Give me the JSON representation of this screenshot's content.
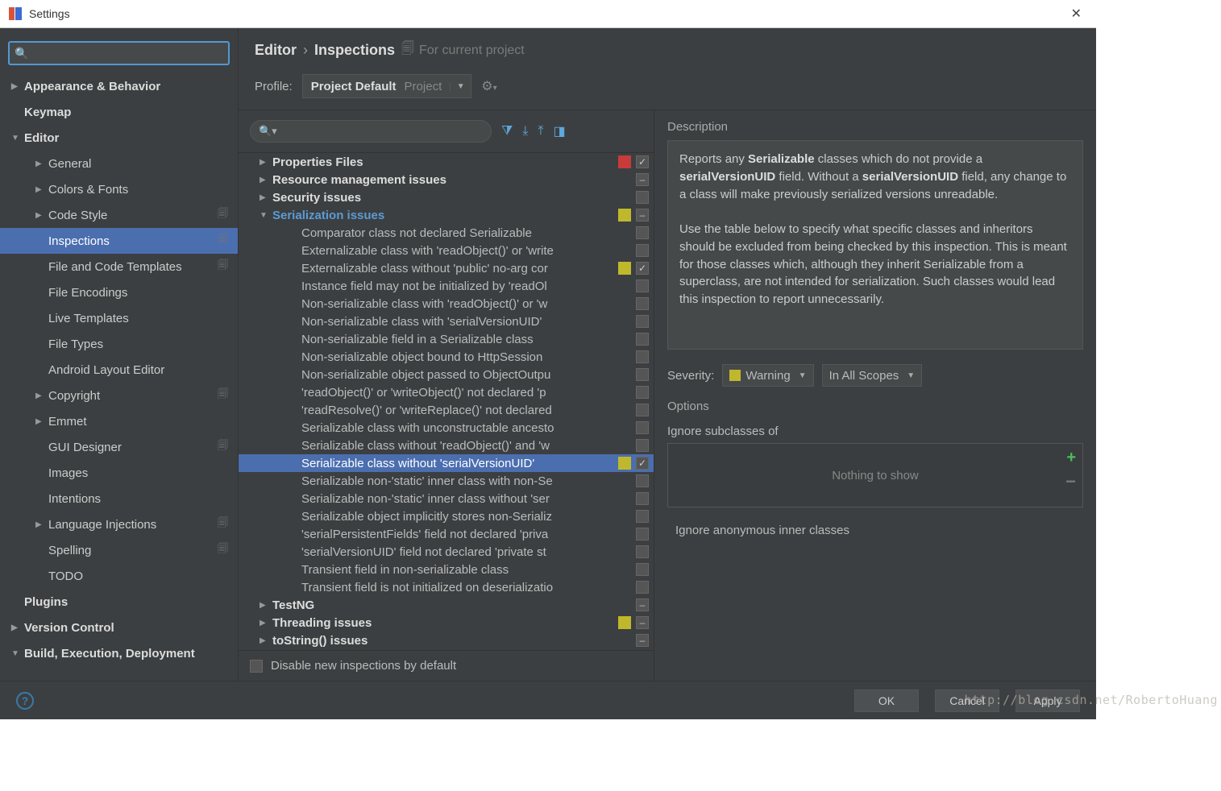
{
  "titlebar": {
    "title": "Settings"
  },
  "sidebar": {
    "search_placeholder": "",
    "items": [
      {
        "label": "Appearance & Behavior",
        "bold": true,
        "arrow": "closed"
      },
      {
        "label": "Keymap",
        "bold": true
      },
      {
        "label": "Editor",
        "bold": true,
        "arrow": "open"
      },
      {
        "label": "General",
        "sub": 1,
        "arrow": "closed"
      },
      {
        "label": "Colors & Fonts",
        "sub": 1,
        "arrow": "closed"
      },
      {
        "label": "Code Style",
        "sub": 1,
        "arrow": "closed",
        "copy": true
      },
      {
        "label": "Inspections",
        "sub": 1,
        "selected": true,
        "copy": true
      },
      {
        "label": "File and Code Templates",
        "sub": 1,
        "copy": true
      },
      {
        "label": "File Encodings",
        "sub": 1
      },
      {
        "label": "Live Templates",
        "sub": 1
      },
      {
        "label": "File Types",
        "sub": 1
      },
      {
        "label": "Android Layout Editor",
        "sub": 1
      },
      {
        "label": "Copyright",
        "sub": 1,
        "arrow": "closed",
        "copy": true
      },
      {
        "label": "Emmet",
        "sub": 1,
        "arrow": "closed"
      },
      {
        "label": "GUI Designer",
        "sub": 1,
        "copy": true
      },
      {
        "label": "Images",
        "sub": 1
      },
      {
        "label": "Intentions",
        "sub": 1
      },
      {
        "label": "Language Injections",
        "sub": 1,
        "arrow": "closed",
        "copy": true
      },
      {
        "label": "Spelling",
        "sub": 1,
        "copy": true
      },
      {
        "label": "TODO",
        "sub": 1
      },
      {
        "label": "Plugins",
        "bold": true
      },
      {
        "label": "Version Control",
        "bold": true,
        "arrow": "closed"
      },
      {
        "label": "Build, Execution, Deployment",
        "bold": true,
        "arrow": "open"
      }
    ]
  },
  "breadcrumb": {
    "root": "Editor",
    "leaf": "Inspections",
    "scope": "For current project"
  },
  "profile": {
    "label": "Profile:",
    "name": "Project Default",
    "hint": "Project"
  },
  "inspections": {
    "search_placeholder": "",
    "rows": [
      {
        "type": "cat",
        "arrow": "closed",
        "label": "Properties Files",
        "sq": "red",
        "cb": "checked"
      },
      {
        "type": "cat",
        "arrow": "closed",
        "label": "Resource management issues",
        "cb": "dash"
      },
      {
        "type": "cat",
        "arrow": "closed",
        "label": "Security issues",
        "cb": "off"
      },
      {
        "type": "cat",
        "arrow": "open",
        "label": "Serialization issues",
        "open_blue": true,
        "sq": "yellow",
        "cb": "dash"
      },
      {
        "type": "leaf",
        "label": "Comparator class not declared Serializable",
        "cb": "off"
      },
      {
        "type": "leaf",
        "label": "Externalizable class with 'readObject()' or 'write",
        "cb": "off"
      },
      {
        "type": "leaf",
        "label": "Externalizable class without 'public' no-arg cor",
        "sq": "yellow",
        "cb": "checked"
      },
      {
        "type": "leaf",
        "label": "Instance field may not be initialized by 'readOl",
        "cb": "off"
      },
      {
        "type": "leaf",
        "label": "Non-serializable class with 'readObject()' or 'w",
        "cb": "off"
      },
      {
        "type": "leaf",
        "label": "Non-serializable class with 'serialVersionUID'",
        "cb": "off"
      },
      {
        "type": "leaf",
        "label": "Non-serializable field in a Serializable class",
        "cb": "off"
      },
      {
        "type": "leaf",
        "label": "Non-serializable object bound to HttpSession",
        "cb": "off"
      },
      {
        "type": "leaf",
        "label": "Non-serializable object passed to ObjectOutpu",
        "cb": "off"
      },
      {
        "type": "leaf",
        "label": "'readObject()' or 'writeObject()' not declared 'p",
        "cb": "off"
      },
      {
        "type": "leaf",
        "label": "'readResolve()' or 'writeReplace()' not declared",
        "cb": "off"
      },
      {
        "type": "leaf",
        "label": "Serializable class with unconstructable ancesto",
        "cb": "off"
      },
      {
        "type": "leaf",
        "label": "Serializable class without 'readObject()' and 'w",
        "cb": "off"
      },
      {
        "type": "leaf",
        "label": "Serializable class without 'serialVersionUID'",
        "sq": "yellow",
        "cb": "checked",
        "selected": true
      },
      {
        "type": "leaf",
        "label": "Serializable non-'static' inner class with non-Se",
        "cb": "off"
      },
      {
        "type": "leaf",
        "label": "Serializable non-'static' inner class without 'ser",
        "cb": "off"
      },
      {
        "type": "leaf",
        "label": "Serializable object implicitly stores non-Serializ",
        "cb": "off"
      },
      {
        "type": "leaf",
        "label": "'serialPersistentFields' field not declared 'priva",
        "cb": "off"
      },
      {
        "type": "leaf",
        "label": "'serialVersionUID' field not declared 'private st",
        "cb": "off"
      },
      {
        "type": "leaf",
        "label": "Transient field in non-serializable class",
        "cb": "off"
      },
      {
        "type": "leaf",
        "label": "Transient field is not initialized on deserializatio",
        "cb": "off"
      },
      {
        "type": "cat",
        "arrow": "closed",
        "label": "TestNG",
        "cb": "dash"
      },
      {
        "type": "cat",
        "arrow": "closed",
        "label": "Threading issues",
        "sq": "yellow",
        "cb": "dash"
      },
      {
        "type": "cat",
        "arrow": "closed",
        "label": "toString() issues",
        "cb": "dash"
      }
    ],
    "disable_default": "Disable new inspections by default"
  },
  "detail": {
    "description_label": "Description",
    "description_p1_a": "Reports any ",
    "description_p1_b": "Serializable",
    "description_p1_c": " classes which do not provide a ",
    "description_p1_d": "serialVersionUID",
    "description_p1_e": " field. Without a ",
    "description_p1_f": "serialVersionUID",
    "description_p1_g": " field, any change to a class will make previously serialized versions unreadable.",
    "description_p2": "Use the table below to specify what specific classes and inheritors should be excluded from being checked by this inspection. This is meant for those classes which, although they inherit Serializable from a superclass, are not intended for serialization. Such classes would lead this inspection to report unnecessarily.",
    "severity_label": "Severity:",
    "severity_value": "Warning",
    "scope_value": "In All Scopes",
    "options_label": "Options",
    "ignore_label": "Ignore subclasses of",
    "empty_text": "Nothing to show",
    "checkbox_label": "Ignore anonymous inner classes"
  },
  "footer": {
    "ok": "OK",
    "cancel": "Cancel",
    "apply": "Apply"
  },
  "watermark": "http://blog.csdn.net/RobertoHuang"
}
